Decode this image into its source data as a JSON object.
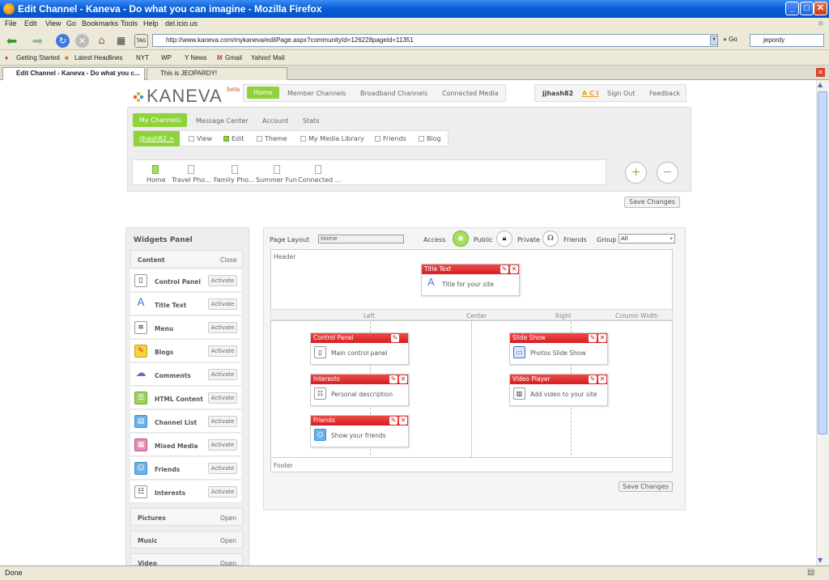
{
  "window": {
    "title": "Edit Channel - Kaneva - Do what you can imagine - Mozilla Firefox"
  },
  "menu": [
    "File",
    "Edit",
    "View",
    "Go",
    "Bookmarks",
    "Tools",
    "Help",
    "del.icio.us"
  ],
  "nav": {
    "url": "http://www.kaneva.com/mykaneva/editPage.aspx?communityId=126228pageId=11351",
    "go_label": "Go",
    "search_value": "jepordy",
    "tag_label": "TAG"
  },
  "bookmarks": [
    "Getting Started",
    "Latest Headlines",
    "NYT",
    "WP",
    "Y News",
    "Gmail",
    "Yahoo! Mail"
  ],
  "tabs": [
    "Edit Channel - Kaneva - Do what you c...",
    "This is JEOPARDY!"
  ],
  "status": "Done",
  "site": {
    "logo": "KANEVA",
    "beta": "beta",
    "topnav": [
      "Home",
      "Member Channels",
      "Broadband Channels",
      "Connected Media"
    ],
    "user": {
      "name": "jjhash82",
      "aci": "A C I",
      "signout": "Sign Out",
      "feedback": "Feedback"
    },
    "mytabs": [
      "My Channels",
      "Message Center",
      "Account",
      "Stats"
    ],
    "subrow": {
      "user": "jjhash82 >",
      "items": [
        "View",
        "Edit",
        "Theme",
        "My Media Library",
        "Friends",
        "Blog"
      ]
    },
    "pages": [
      "Home",
      "Travel Pho...",
      "Family Pho...",
      "Summer Fun",
      "Connected ..."
    ],
    "save_changes": "Save Changes"
  },
  "widgets_panel": {
    "title": "Widgets Panel",
    "content_label": "Content",
    "close_label": "Close",
    "activate_label": "Activate",
    "open_label": "Open",
    "items": [
      "Control Panel",
      "Title Text",
      "Menu",
      "Blogs",
      "Comments",
      "HTML Content",
      "Channel List",
      "Mixed Media",
      "Friends",
      "Interests"
    ],
    "groups": [
      "Pictures",
      "Music",
      "Video"
    ]
  },
  "editor": {
    "page_layout_label": "Page Layout",
    "page_layout_value": "Home",
    "access_label": "Access",
    "public": "Public",
    "private": "Private",
    "friends": "Friends",
    "group_label": "Group",
    "group_value": "All",
    "header": "Header",
    "footer": "Footer",
    "col_left": "Left",
    "col_center": "Center",
    "col_right": "Right",
    "col_slider": "Column Width Slider",
    "widgets": {
      "title": {
        "head": "Title Text",
        "text": "Title for your site"
      },
      "control": {
        "head": "Control Panel",
        "text": "Main control panel"
      },
      "interests": {
        "head": "Interests",
        "text": "Personal description"
      },
      "friends": {
        "head": "Friends",
        "text": "Show your friends"
      },
      "slideshow": {
        "head": "Slide Show",
        "text": "Photos Slide Show"
      },
      "video": {
        "head": "Video Player",
        "text": "Add video to your site"
      }
    }
  }
}
